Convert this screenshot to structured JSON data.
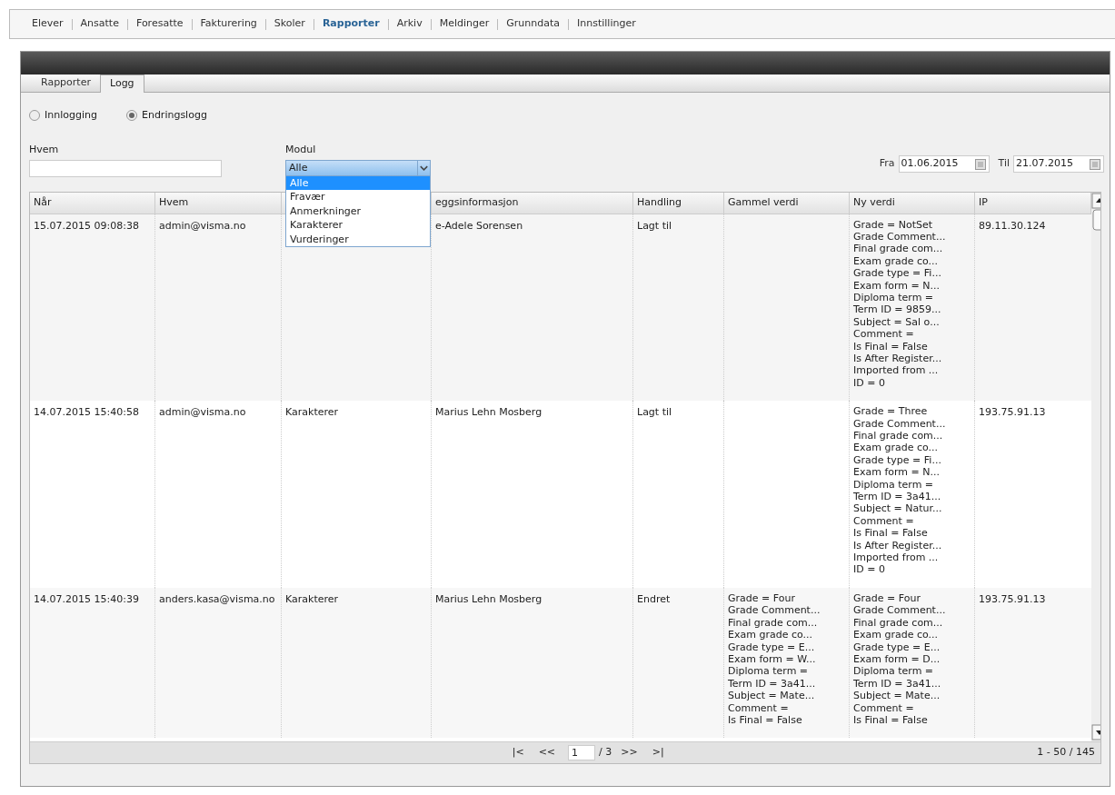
{
  "nav": [
    {
      "label": "Elever",
      "selected": false
    },
    {
      "label": "Ansatte",
      "selected": false
    },
    {
      "label": "Foresatte",
      "selected": false
    },
    {
      "label": "Fakturering",
      "selected": false
    },
    {
      "label": "Skoler",
      "selected": false
    },
    {
      "label": "Rapporter",
      "selected": true
    },
    {
      "label": "Arkiv",
      "selected": false
    },
    {
      "label": "Meldinger",
      "selected": false
    },
    {
      "label": "Grunndata",
      "selected": false
    },
    {
      "label": "Innstillinger",
      "selected": false
    }
  ],
  "tabs": [
    {
      "label": "Rapporter",
      "selected": false
    },
    {
      "label": "Logg",
      "selected": true
    }
  ],
  "log_type": [
    {
      "label": "Innlogging",
      "selected": false
    },
    {
      "label": "Endringslogg",
      "selected": true
    }
  ],
  "filters": {
    "who": {
      "label": "Hvem"
    },
    "module": {
      "label": "Modul",
      "value": "Alle",
      "expanded": true,
      "options": [
        {
          "label": "Alle",
          "selected": true
        },
        {
          "label": "Fravær",
          "selected": false
        },
        {
          "label": "Anmerkninger",
          "selected": false
        },
        {
          "label": "Karakterer",
          "selected": false
        },
        {
          "label": "Vurderinger",
          "selected": false
        }
      ]
    },
    "from": {
      "label": "Fra",
      "value": "01.06.2015"
    },
    "to": {
      "label": "Til",
      "value": "21.07.2015"
    }
  },
  "table": {
    "columns": [
      {
        "label": "Når"
      },
      {
        "label": "Hvem"
      },
      {},
      {
        "label": "eggsinformasjon"
      },
      {
        "label": "Handling"
      },
      {
        "label": "Gammel verdi"
      },
      {
        "label": "Ny verdi"
      },
      {
        "label": "IP"
      }
    ],
    "rows": [
      {
        "when": "15.07.2015 09:08:38",
        "who": "admin@visma.no",
        "info": "e-Adele Sorensen",
        "action": "Lagt til",
        "new_value": [
          "Grade = NotSet",
          "Grade Comment...",
          "Final grade com...",
          "Exam grade co...",
          "Grade type = Fi...",
          "Exam form = N...",
          "Diploma term =",
          "Term ID = 9859...",
          "Subject = Sal o...",
          "Comment =",
          "Is Final = False",
          "Is After Register...",
          "Imported from ...",
          "ID = 0"
        ],
        "ip": "89.11.30.124"
      },
      {
        "when": "14.07.2015 15:40:58",
        "who": "admin@visma.no",
        "module": "Karakterer",
        "info": "Marius Lehn Mosberg",
        "action": "Lagt til",
        "new_value": [
          "Grade = Three",
          "Grade Comment...",
          "Final grade com...",
          "Exam grade co...",
          "Grade type = Fi...",
          "Exam form = N...",
          "Diploma term =",
          "Term ID = 3a41...",
          "Subject = Natur...",
          "Comment =",
          "Is Final = False",
          "Is After Register...",
          "Imported from ...",
          "ID = 0"
        ],
        "ip": "193.75.91.13"
      },
      {
        "when": "14.07.2015 15:40:39",
        "who": "anders.kasa@visma.no",
        "module": "Karakterer",
        "info": "Marius Lehn Mosberg",
        "action": "Endret",
        "old_value": [
          "Grade = Four",
          "Grade Comment...",
          "Final grade com...",
          "Exam grade co...",
          "Grade type = E...",
          "Exam form = W...",
          "Diploma term =",
          "Term ID = 3a41...",
          "Subject = Mate...",
          "Comment =",
          "Is Final = False"
        ],
        "new_value": [
          "Grade = Four",
          "Grade Comment...",
          "Final grade com...",
          "Exam grade co...",
          "Grade type = E...",
          "Exam form = D...",
          "Diploma term =",
          "Term ID = 3a41...",
          "Subject = Mate...",
          "Comment =",
          "Is Final = False"
        ],
        "ip": "193.75.91.13"
      }
    ]
  },
  "pager": {
    "first": "|<",
    "prev": "<<",
    "page": "1",
    "of": "/ 3",
    "next": ">>",
    "last": ">|",
    "range": "1 - 50 / 145"
  }
}
